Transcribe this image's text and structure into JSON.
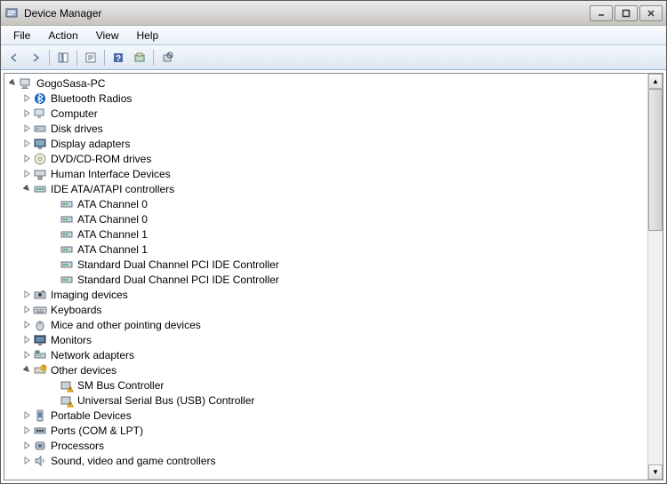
{
  "window": {
    "title": "Device Manager"
  },
  "menu": {
    "file": "File",
    "action": "Action",
    "view": "View",
    "help": "Help"
  },
  "tree": {
    "root": "GogoSasa-PC",
    "categories": [
      {
        "label": "Bluetooth Radios",
        "expanded": false,
        "icon": "bluetooth"
      },
      {
        "label": "Computer",
        "expanded": false,
        "icon": "computer"
      },
      {
        "label": "Disk drives",
        "expanded": false,
        "icon": "disk"
      },
      {
        "label": "Display adapters",
        "expanded": false,
        "icon": "display"
      },
      {
        "label": "DVD/CD-ROM drives",
        "expanded": false,
        "icon": "cdrom"
      },
      {
        "label": "Human Interface Devices",
        "expanded": false,
        "icon": "hid"
      },
      {
        "label": "IDE ATA/ATAPI controllers",
        "expanded": true,
        "icon": "ide",
        "children": [
          "ATA Channel 0",
          "ATA Channel 0",
          "ATA Channel 1",
          "ATA Channel 1",
          "Standard Dual Channel PCI IDE Controller",
          "Standard Dual Channel PCI IDE Controller"
        ]
      },
      {
        "label": "Imaging devices",
        "expanded": false,
        "icon": "imaging"
      },
      {
        "label": "Keyboards",
        "expanded": false,
        "icon": "keyboard"
      },
      {
        "label": "Mice and other pointing devices",
        "expanded": false,
        "icon": "mouse"
      },
      {
        "label": "Monitors",
        "expanded": false,
        "icon": "monitor"
      },
      {
        "label": "Network adapters",
        "expanded": false,
        "icon": "network"
      },
      {
        "label": "Other devices",
        "expanded": true,
        "icon": "other",
        "children": [
          "SM Bus Controller",
          "Universal Serial Bus (USB) Controller"
        ],
        "childWarning": true
      },
      {
        "label": "Portable Devices",
        "expanded": false,
        "icon": "portable"
      },
      {
        "label": "Ports (COM & LPT)",
        "expanded": false,
        "icon": "ports"
      },
      {
        "label": "Processors",
        "expanded": false,
        "icon": "processor"
      },
      {
        "label": "Sound, video and game controllers",
        "expanded": false,
        "icon": "sound"
      }
    ]
  }
}
